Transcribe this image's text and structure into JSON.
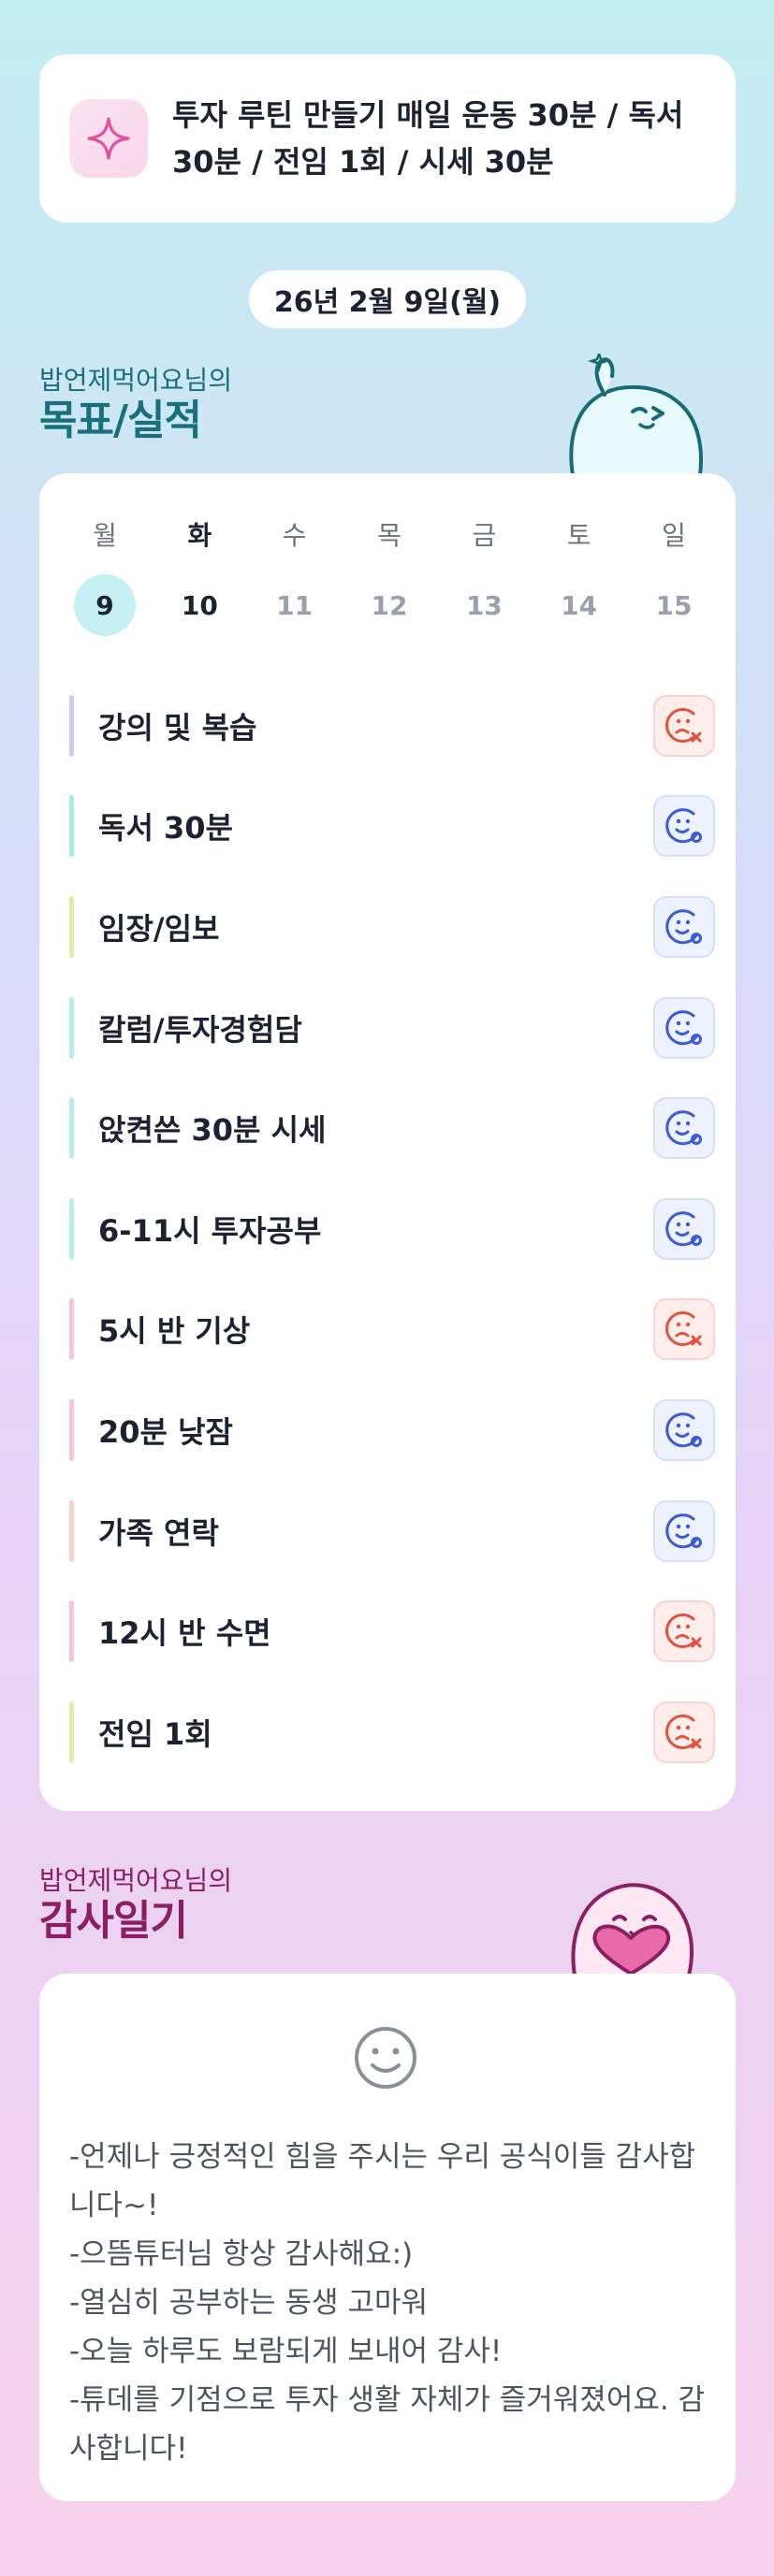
{
  "goal": {
    "icon": "sparkle-icon",
    "text": "투자 루틴 만들기 매일 운동 30분 / 독서 30분 / 전임 1회 / 시세 30분"
  },
  "date_label": "26년 2월 9일(월)",
  "routine_section": {
    "subtitle": "밥언제먹어요님의",
    "title": "목표/실적"
  },
  "week": [
    {
      "day": "월",
      "num": "9"
    },
    {
      "day": "화",
      "num": "10"
    },
    {
      "day": "수",
      "num": "11"
    },
    {
      "day": "목",
      "num": "12"
    },
    {
      "day": "금",
      "num": "13"
    },
    {
      "day": "토",
      "num": "14"
    },
    {
      "day": "일",
      "num": "15"
    }
  ],
  "tasks": [
    {
      "label": "강의 및 복습",
      "status": "fail",
      "bar_color": "#c9cdf6"
    },
    {
      "label": "독서 30분",
      "status": "done",
      "bar_color": "#a6ece2"
    },
    {
      "label": "임장/임보",
      "status": "done",
      "bar_color": "#d8f0a8"
    },
    {
      "label": "칼럼/투자경험담",
      "status": "done",
      "bar_color": "#b7eef2"
    },
    {
      "label": "앉켠쓴 30분 시세",
      "status": "done",
      "bar_color": "#b7eef2"
    },
    {
      "label": "6-11시 투자공부",
      "status": "done",
      "bar_color": "#b7eef2"
    },
    {
      "label": "5시 반 기상",
      "status": "fail",
      "bar_color": "#f8c4dc"
    },
    {
      "label": "20분 낮잠",
      "status": "done",
      "bar_color": "#f8c4dc"
    },
    {
      "label": "가족 연락",
      "status": "done",
      "bar_color": "#fbd0cc"
    },
    {
      "label": "12시 반 수면",
      "status": "fail",
      "bar_color": "#f8c4dc"
    },
    {
      "label": "전임 1회",
      "status": "fail",
      "bar_color": "#d8f0a8"
    }
  ],
  "thanks_section": {
    "subtitle": "밥언제먹어요님의",
    "title": "감사일기"
  },
  "thanks": {
    "mood_icon": "smile-face-icon",
    "lines": [
      "-언제나 긍정적인 힘을 주시는 우리 공식이들 감사합니다~!",
      "-으뜸튜터님 항상 감사해요:)",
      "-열심히 공부하는 동생 고마워",
      "-오늘 하루도 보람되게 보내어 감사!",
      "-튜데를 기점으로 투자 생활 자체가 즐거워졌어요. 감사합니다!"
    ]
  },
  "colors": {
    "done": "#3b5bdb",
    "fail": "#e0533f",
    "routine_header": "#17707a",
    "thanks_header": "#8c1f63"
  }
}
